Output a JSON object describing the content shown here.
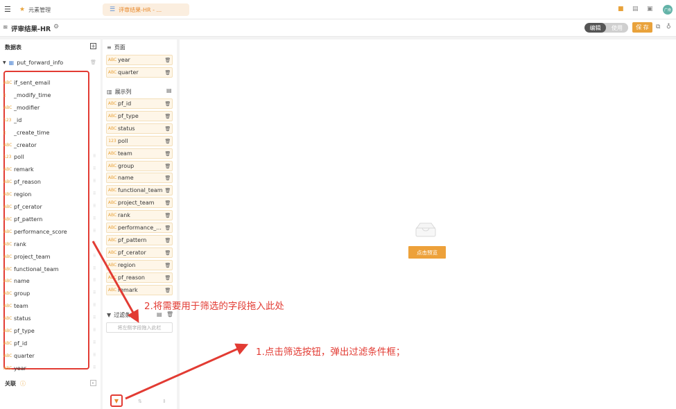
{
  "topbar": {
    "tabs": [
      {
        "label": "元素管理",
        "icon": "star-icon"
      },
      {
        "label": "评审结果-HR - ...",
        "icon": "list-icon"
      }
    ],
    "avatar_text": "广南"
  },
  "titlebar": {
    "title": "评审结果-HR",
    "mode_edit": "编辑",
    "mode_use": "使用",
    "save_label": "保 存"
  },
  "datatable": {
    "header": "数据表",
    "table_name": "put_forward_info",
    "fields": [
      {
        "type": "ABC",
        "name": "if_sent_email"
      },
      {
        "type": "date",
        "name": "_modify_time"
      },
      {
        "type": "ABC",
        "name": "_modifier"
      },
      {
        "type": "123",
        "name": "_id"
      },
      {
        "type": "date",
        "name": "_create_time"
      },
      {
        "type": "ABC",
        "name": "_creator"
      },
      {
        "type": "123",
        "name": "poll"
      },
      {
        "type": "ABC",
        "name": "remark"
      },
      {
        "type": "ABC",
        "name": "pf_reason"
      },
      {
        "type": "ABC",
        "name": "region"
      },
      {
        "type": "ABC",
        "name": "pf_cerator"
      },
      {
        "type": "ABC",
        "name": "pf_pattern"
      },
      {
        "type": "ABC",
        "name": "performance_score"
      },
      {
        "type": "ABC",
        "name": "rank"
      },
      {
        "type": "ABC",
        "name": "project_team"
      },
      {
        "type": "ABC",
        "name": "functional_team"
      },
      {
        "type": "ABC",
        "name": "name"
      },
      {
        "type": "ABC",
        "name": "group"
      },
      {
        "type": "ABC",
        "name": "team"
      },
      {
        "type": "ABC",
        "name": "status"
      },
      {
        "type": "ABC",
        "name": "pf_type"
      },
      {
        "type": "ABC",
        "name": "pf_id"
      },
      {
        "type": "ABC",
        "name": "quarter"
      },
      {
        "type": "ABC",
        "name": "year"
      }
    ],
    "assoc_label": "关联"
  },
  "page_section": {
    "label": "页面",
    "fields": [
      {
        "type": "ABC",
        "name": "year"
      },
      {
        "type": "ABC",
        "name": "quarter"
      }
    ]
  },
  "columns_section": {
    "label": "展示列",
    "fields": [
      {
        "type": "ABC",
        "name": "pf_id"
      },
      {
        "type": "ABC",
        "name": "pf_type"
      },
      {
        "type": "ABC",
        "name": "status"
      },
      {
        "type": "123",
        "name": "poll"
      },
      {
        "type": "ABC",
        "name": "team"
      },
      {
        "type": "ABC",
        "name": "group"
      },
      {
        "type": "ABC",
        "name": "name"
      },
      {
        "type": "ABC",
        "name": "functional_team"
      },
      {
        "type": "ABC",
        "name": "project_team"
      },
      {
        "type": "ABC",
        "name": "rank"
      },
      {
        "type": "ABC",
        "name": "performance_..."
      },
      {
        "type": "ABC",
        "name": "pf_pattern"
      },
      {
        "type": "ABC",
        "name": "pf_cerator"
      },
      {
        "type": "ABC",
        "name": "region"
      },
      {
        "type": "ABC",
        "name": "pf_reason"
      },
      {
        "type": "ABC",
        "name": "remark"
      }
    ]
  },
  "filter_section": {
    "label": "过滤条",
    "placeholder": "将左侧字段拖入此栏"
  },
  "canvas": {
    "preview_label": "点击预览"
  },
  "annotations": {
    "step1": "1.点击筛选按钮，弹出过滤条件框；",
    "step2": "2.将需要用于筛选的字段拖入此处"
  },
  "colors": {
    "accent": "#e9a23b",
    "annotation_red": "#e23b33",
    "tab_active_bg": "#fbeedf"
  }
}
